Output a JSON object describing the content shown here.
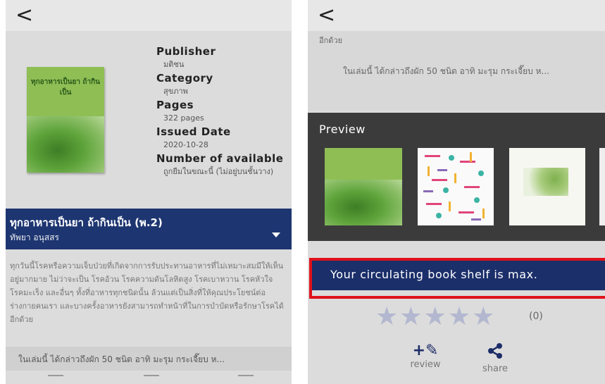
{
  "left": {
    "back": "<",
    "cover_title": "ทุกอาหารเป็นยา ถ้ากินเป็น",
    "meta": [
      {
        "label": "Publisher",
        "value": "มติชน"
      },
      {
        "label": "Category",
        "value": "สุขภาพ"
      },
      {
        "label": "Pages",
        "value": "322 pages"
      },
      {
        "label": "Issued Date",
        "value": "2020-10-28"
      },
      {
        "label": "Number of available",
        "value": "ถูกยืมในขณะนี้ (ไม่อยู่บนชั้นวาง)"
      }
    ],
    "book_title": "ทุกอาหารเป็นยา ถ้ากินเป็น (พ.2)",
    "author": "ทัพยา อนุสสร",
    "description": "ทุกวันนี้โรคหรือความเจ็บป่วยที่เกิดจากการรับประทานอาหารที่ไม่เหมาะสมมีให้เห็นอยู่มากมาย ไม่ว่าจะเป็น โรคอ้วน โรคความดันโลหิตสูง โรคเบาหวาน โรคหัวใจ โรคมะเร็ง และอื่นๆ ทั้งที่อาหารทุกชนิดนั้น ล้วนแต่เป็นสิ่งที่ให้คุณประโยชน์ต่อร่างกายคนเรา และบางครั้งอาหารยังสามารถทำหน้าที่ในการบำบัดหรือรักษาโรคได้อีกด้วย",
    "excerpt": "ในเล่มนี้ ได้กล่าวถึงผัก 50 ชนิด อาทิ มะรุม กระเจี๊ยบ ห..."
  },
  "right": {
    "back": "<",
    "extra_1": "อีกด้วย",
    "extra_2": "ในเล่มนี้ ได้กล่าวถึงผัก 50 ชนิด อาทิ มะรุม กระเจี๊ยบ ห...",
    "preview_label": "Preview",
    "max_message": "Your circulating book shelf is max.",
    "stars": [
      "★",
      "★",
      "★",
      "★",
      "★"
    ],
    "rating_count": "(0)",
    "review_icon": "+✎",
    "review_label": "review",
    "share_icon": "<",
    "share_label": "share"
  },
  "colors": {
    "navy": "#1d3570",
    "highlight": "#e0111b",
    "star": "#b3b7cf"
  }
}
